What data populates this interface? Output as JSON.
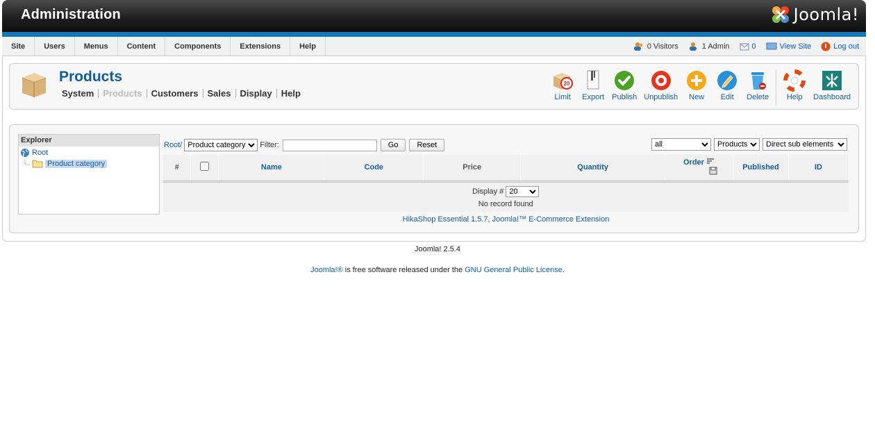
{
  "header": {
    "title": "Administration",
    "logo_text": "Joomla!"
  },
  "menu": [
    "Site",
    "Users",
    "Menus",
    "Content",
    "Components",
    "Extensions",
    "Help"
  ],
  "status": {
    "visitors": "0 Visitors",
    "admins": "1 Admin",
    "messages": "0",
    "view_site": "View Site",
    "logout": "Log out"
  },
  "page": {
    "title": "Products",
    "subnav": [
      {
        "label": "System",
        "disabled": false
      },
      {
        "label": "Products",
        "disabled": true
      },
      {
        "label": "Customers",
        "disabled": false
      },
      {
        "label": "Sales",
        "disabled": false
      },
      {
        "label": "Display",
        "disabled": false
      },
      {
        "label": "Help",
        "disabled": false
      }
    ]
  },
  "toolbar": {
    "limit": "Limit",
    "limit_badge": "20",
    "export": "Export",
    "publish": "Publish",
    "unpublish": "Unpublish",
    "new": "New",
    "edit": "Edit",
    "delete": "Delete",
    "help": "Help",
    "dashboard": "Dashboard"
  },
  "explorer": {
    "heading": "Explorer",
    "root": "Root",
    "child": "Product category"
  },
  "filters": {
    "path_root": "Root/",
    "category": "Product category",
    "filter_label": "Filter:",
    "filter_value": "",
    "go": "Go",
    "reset": "Reset",
    "publish_state": "all",
    "type": "Products",
    "scope": "Direct sub elements"
  },
  "table": {
    "columns": {
      "num": "#",
      "name": "Name",
      "code": "Code",
      "price": "Price",
      "quantity": "Quantity",
      "order": "Order",
      "published": "Published",
      "id": "ID"
    },
    "display_label": "Display #",
    "display_value": "20",
    "empty": "No record found",
    "footer": "HikaShop Essential 1.5.7, Joomla!™ E-Commerce Extension"
  },
  "footer": {
    "version": "Joomla! 2.5.4",
    "license_link1": "Joomla!®",
    "license_text": " is free software released under the ",
    "license_link2": "GNU General Public License",
    "license_end": "."
  },
  "colors": {
    "accent": "#135c9a",
    "header_bar": "#1376b6"
  }
}
